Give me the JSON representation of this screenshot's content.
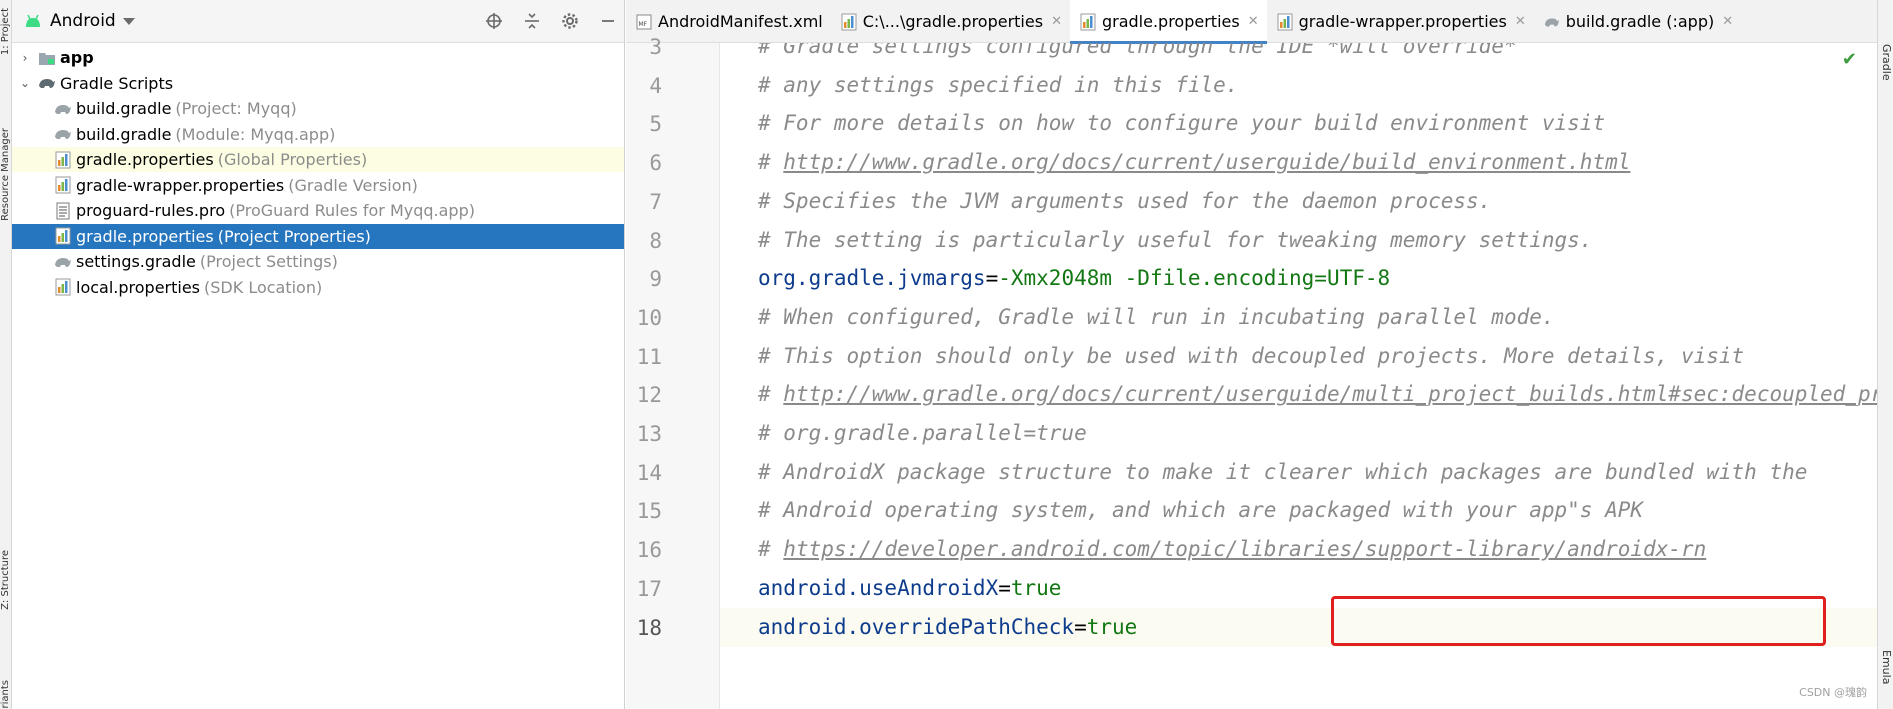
{
  "left_strip": {
    "labels": [
      "1: Project",
      "Resource Manager",
      "Z: Structure",
      "Variants"
    ]
  },
  "project_panel": {
    "title": "Android",
    "tree": [
      {
        "label": "app",
        "hint": "",
        "kind": "module",
        "expandable": true,
        "expanded": false,
        "bold": true
      },
      {
        "label": "Gradle Scripts",
        "hint": "",
        "kind": "gradle-folder",
        "expandable": true,
        "expanded": true
      },
      {
        "label": "build.gradle",
        "hint": "(Project: Myqq)",
        "kind": "gradle-file"
      },
      {
        "label": "build.gradle",
        "hint": "(Module: Myqq.app)",
        "kind": "gradle-file"
      },
      {
        "label": "gradle.properties",
        "hint": "(Global Properties)",
        "kind": "properties-file",
        "state": "highlight"
      },
      {
        "label": "gradle-wrapper.properties",
        "hint": "(Gradle Version)",
        "kind": "properties-file"
      },
      {
        "label": "proguard-rules.pro",
        "hint": "(ProGuard Rules for Myqq.app)",
        "kind": "text-file"
      },
      {
        "label": "gradle.properties",
        "hint": "(Project Properties)",
        "kind": "properties-file",
        "state": "selected"
      },
      {
        "label": "settings.gradle",
        "hint": "(Project Settings)",
        "kind": "gradle-file"
      },
      {
        "label": "local.properties",
        "hint": "(SDK Location)",
        "kind": "properties-file"
      }
    ]
  },
  "editor": {
    "tabs": [
      {
        "label": "AndroidManifest.xml",
        "icon": "xml-file-icon",
        "closable": false,
        "active": false
      },
      {
        "label": "C:\\...\\gradle.properties",
        "icon": "properties-file-icon",
        "closable": true,
        "active": false
      },
      {
        "label": "gradle.properties",
        "icon": "properties-file-icon",
        "closable": true,
        "active": true
      },
      {
        "label": "gradle-wrapper.properties",
        "icon": "properties-file-icon",
        "closable": true,
        "active": false
      },
      {
        "label": "build.gradle (:app)",
        "icon": "gradle-file-icon",
        "closable": true,
        "active": false
      }
    ],
    "lines": [
      {
        "num": "3",
        "parts": [
          {
            "t": "# Gradle settings configured through the IDE *will override*",
            "c": "comment"
          }
        ]
      },
      {
        "num": "4",
        "parts": [
          {
            "t": "# any settings specified in this file.",
            "c": "comment"
          }
        ]
      },
      {
        "num": "5",
        "parts": [
          {
            "t": "# For more details on how to configure your build environment visit",
            "c": "comment"
          }
        ]
      },
      {
        "num": "6",
        "parts": [
          {
            "t": "# ",
            "c": "comment"
          },
          {
            "t": "http://www.gradle.org/docs/current/userguide/build_environment.html",
            "c": "comment clink"
          }
        ]
      },
      {
        "num": "7",
        "parts": [
          {
            "t": "# Specifies the JVM arguments used for the daemon process.",
            "c": "comment"
          }
        ]
      },
      {
        "num": "8",
        "parts": [
          {
            "t": "# The setting is particularly useful for tweaking memory settings.",
            "c": "comment"
          }
        ]
      },
      {
        "num": "9",
        "parts": [
          {
            "t": "org.gradle.jvmargs",
            "c": "key"
          },
          {
            "t": "=",
            "c": "eq"
          },
          {
            "t": "-Xmx2048m -Dfile.encoding=UTF-8",
            "c": "val"
          }
        ]
      },
      {
        "num": "10",
        "parts": [
          {
            "t": "# When configured, Gradle will run in incubating parallel mode.",
            "c": "comment"
          }
        ]
      },
      {
        "num": "11",
        "parts": [
          {
            "t": "# This option should only be used with decoupled projects. More details, visit",
            "c": "comment"
          }
        ]
      },
      {
        "num": "12",
        "parts": [
          {
            "t": "# ",
            "c": "comment"
          },
          {
            "t": "http://www.gradle.org/docs/current/userguide/multi_project_builds.html#sec:decoupled_projects",
            "c": "comment clink"
          }
        ]
      },
      {
        "num": "13",
        "parts": [
          {
            "t": "# org.gradle.parallel=true",
            "c": "comment"
          }
        ]
      },
      {
        "num": "14",
        "parts": [
          {
            "t": "# AndroidX package structure to make it clearer which packages are bundled with the",
            "c": "comment"
          }
        ]
      },
      {
        "num": "15",
        "parts": [
          {
            "t": "# Android operating system, and which are packaged with your app\"s APK",
            "c": "comment"
          }
        ]
      },
      {
        "num": "16",
        "parts": [
          {
            "t": "# ",
            "c": "comment"
          },
          {
            "t": "https://developer.android.com/topic/libraries/support-library/androidx-rn",
            "c": "comment clink"
          }
        ]
      },
      {
        "num": "17",
        "parts": [
          {
            "t": "android.useAndroidX",
            "c": "key"
          },
          {
            "t": "=",
            "c": "eq"
          },
          {
            "t": "true",
            "c": "val"
          }
        ]
      },
      {
        "num": "18",
        "parts": [
          {
            "t": "android.overridePathCheck",
            "c": "key"
          },
          {
            "t": "=",
            "c": "eq"
          },
          {
            "t": "true",
            "c": "val"
          }
        ],
        "current": true
      }
    ]
  },
  "right_strip": {
    "labels": [
      "Gradle",
      "Emula"
    ]
  },
  "watermark": "CSDN @瑰韵",
  "colors": {
    "selection": "#2675bf",
    "annotation": "#e0201e",
    "key": "#0e3c8c",
    "value": "#137813",
    "comment": "#8a8a8a"
  }
}
